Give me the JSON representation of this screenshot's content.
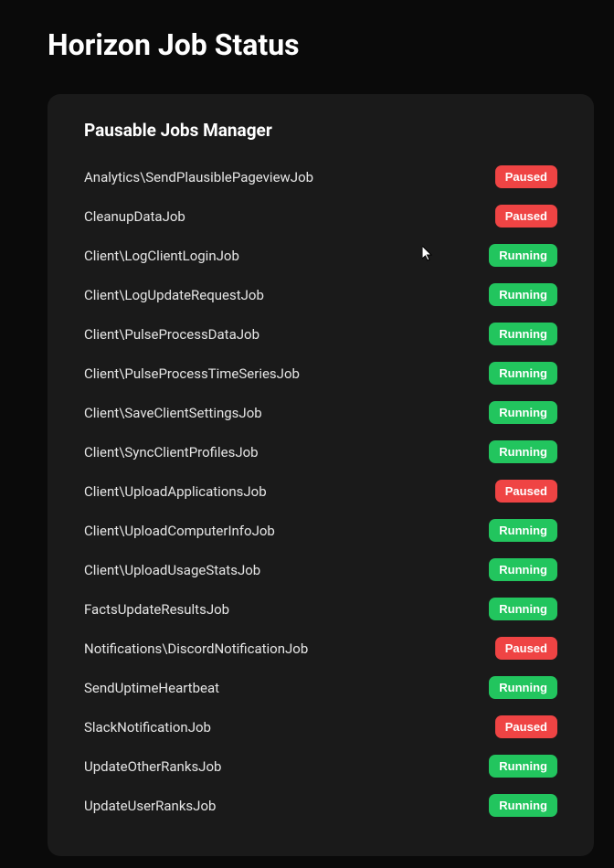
{
  "page": {
    "title": "Horizon Job Status"
  },
  "panel": {
    "title": "Pausable Jobs Manager"
  },
  "status_labels": {
    "running": "Running",
    "paused": "Paused"
  },
  "jobs": [
    {
      "name": "Analytics\\SendPlausiblePageviewJob",
      "status": "paused"
    },
    {
      "name": "CleanupDataJob",
      "status": "paused"
    },
    {
      "name": "Client\\LogClientLoginJob",
      "status": "running"
    },
    {
      "name": "Client\\LogUpdateRequestJob",
      "status": "running"
    },
    {
      "name": "Client\\PulseProcessDataJob",
      "status": "running"
    },
    {
      "name": "Client\\PulseProcessTimeSeriesJob",
      "status": "running"
    },
    {
      "name": "Client\\SaveClientSettingsJob",
      "status": "running"
    },
    {
      "name": "Client\\SyncClientProfilesJob",
      "status": "running"
    },
    {
      "name": "Client\\UploadApplicationsJob",
      "status": "paused"
    },
    {
      "name": "Client\\UploadComputerInfoJob",
      "status": "running"
    },
    {
      "name": "Client\\UploadUsageStatsJob",
      "status": "running"
    },
    {
      "name": "FactsUpdateResultsJob",
      "status": "running"
    },
    {
      "name": "Notifications\\DiscordNotificationJob",
      "status": "paused"
    },
    {
      "name": "SendUptimeHeartbeat",
      "status": "running"
    },
    {
      "name": "SlackNotificationJob",
      "status": "paused"
    },
    {
      "name": "UpdateOtherRanksJob",
      "status": "running"
    },
    {
      "name": "UpdateUserRanksJob",
      "status": "running"
    }
  ]
}
